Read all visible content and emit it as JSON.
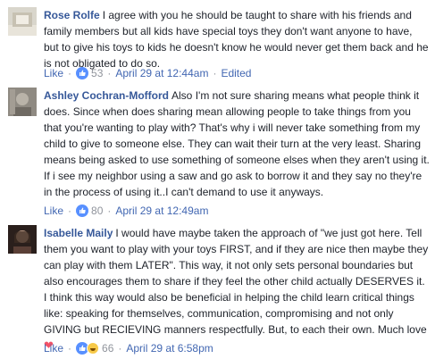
{
  "comments": [
    {
      "author": "Rose Rolfe",
      "text": "I agree with you he should be taught to share with his friends and family members but all kids have special toys they don't want anyone to have, but to give his toys to kids he doesn't know he would never get them back and he is not obligated to do so.",
      "like_label": "Like",
      "reaction_count": "53",
      "timestamp": "April 29 at 12:44am",
      "edited_label": "Edited"
    },
    {
      "author": "Ashley Cochran-Mofford",
      "text": "Also I'm not sure sharing means what people think it does. Since when does sharing mean allowing people to take things from you that you're wanting to play with? That's why i will never take something from my child to give to someone else. They can wait their turn at the very least. Sharing means being asked to use something of someone elses when they aren't using it. If i see my neighbor using a saw and go ask to borrow it and they say no they're in the process of using it..I can't demand to use it anyways.",
      "like_label": "Like",
      "reaction_count": "80",
      "timestamp": "April 29 at 12:49am"
    },
    {
      "author": "Isabelle Maily",
      "text": "I would have maybe taken the approach of \"we just got here. Tell them you want to play with your toys FIRST, and if they are nice then maybe they can play with them LATER\". This way, it not only sets personal boundaries but also encourages them to share if they feel the other child actually DESERVES it. I think this way would also be beneficial in helping the child learn critical things like: speaking for themselves, communication, compromising and not only GIVING but RECIEVING manners respectfully. But, to each their own. Much love",
      "emoji": "❤",
      "like_label": "Like",
      "reaction_count": "66",
      "timestamp": "April 29 at 6:58pm"
    }
  ],
  "meta_separator": "·",
  "colors": {
    "author": "#365899",
    "link": "#4267b2",
    "meta": "#90949c",
    "like_reaction": "#5890ff",
    "haha_reaction": "#f7c948",
    "heart": "#f25268"
  }
}
